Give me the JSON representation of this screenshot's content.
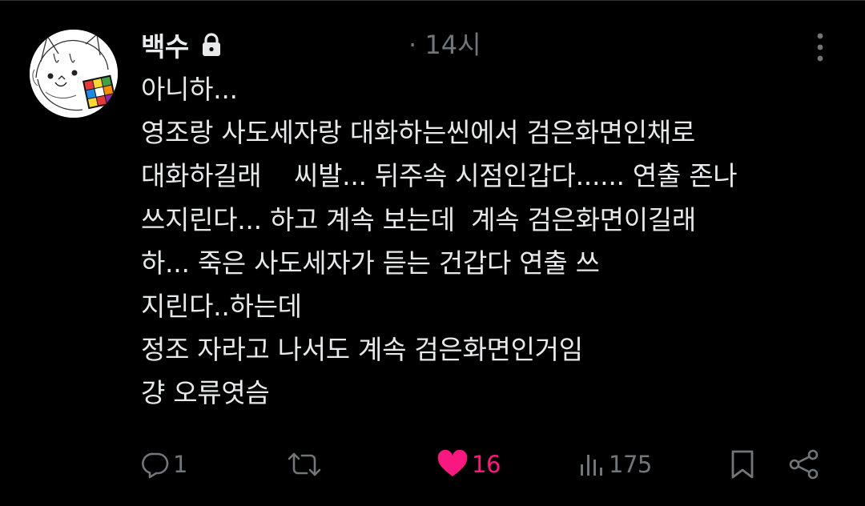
{
  "post": {
    "author": {
      "display_name": "백수",
      "locked": true
    },
    "timestamp": "· 14시",
    "body_lines": [
      "아니하...",
      "영조랑 사도세자랑 대화하는씬에서 검은화면인채로",
      "대화하길래    씨발... 뒤주속 시점인갑다...... 연출 존나",
      "쓰지린다... 하고 계속 보는데  계속 검은화면이길래",
      "하... 죽은 사도세자가 듣는 건갑다 연출 쓰",
      "지린다..하는데",
      "정조 자라고 나서도 계속 검은화면인거임",
      "걍 오류엿슴"
    ],
    "actions": {
      "reply_count": "1",
      "repost_count": "",
      "like_count": "16",
      "view_count": "175"
    }
  },
  "colors": {
    "background": "#000000",
    "text": "#e7e9ea",
    "muted": "#71767b",
    "like": "#f91880"
  },
  "icons": {
    "lock": "lock-icon",
    "more": "more-icon",
    "reply": "reply-icon",
    "repost": "repost-icon",
    "like": "heart-icon",
    "views": "views-icon",
    "bookmark": "bookmark-icon",
    "share": "share-icon"
  }
}
